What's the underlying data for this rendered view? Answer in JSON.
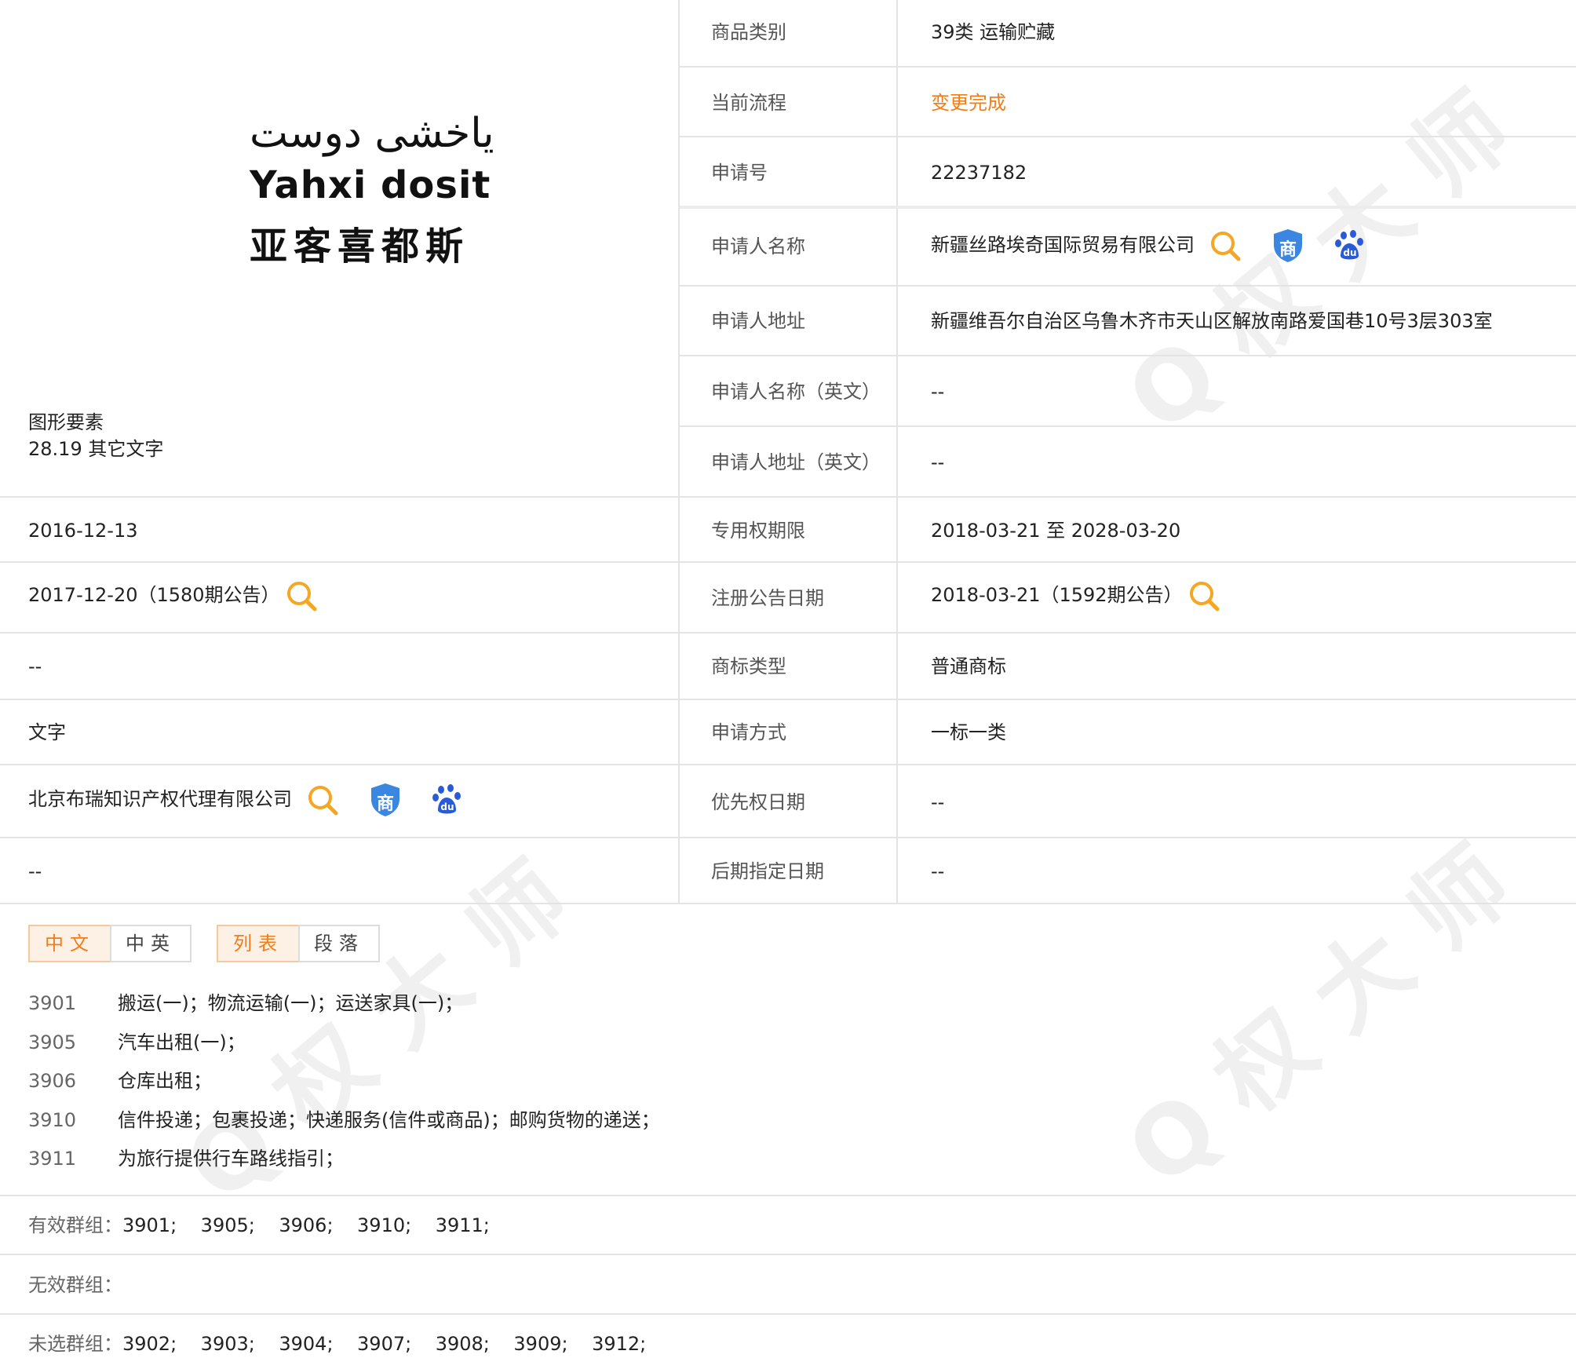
{
  "logo": {
    "arabic": "ياخشى دوست",
    "latin": "Yahxi dosit",
    "chinese": "亚客喜都斯"
  },
  "figure_elements": {
    "label": "图形要素",
    "value": "28.19 其它文字"
  },
  "left_values": {
    "application_date": "2016-12-13",
    "preliminary_notice": "2017-12-20（1580期公告）",
    "row3": "--",
    "mark_form": "文字",
    "agent": "北京布瑞知识产权代理有限公司",
    "row6": "--"
  },
  "right_rows": {
    "goods_class": {
      "label": "商品类别",
      "value": "39类 运输贮藏"
    },
    "process": {
      "label": "当前流程",
      "value": "变更完成"
    },
    "app_no": {
      "label": "申请号",
      "value": "22237182"
    },
    "applicant": {
      "label": "申请人名称",
      "value": "新疆丝路埃奇国际贸易有限公司"
    },
    "address": {
      "label": "申请人地址",
      "value": "新疆维吾尔自治区乌鲁木齐市天山区解放南路爱国巷10号3层303室"
    },
    "applicant_en": {
      "label": "申请人名称（英文）",
      "value": "--"
    },
    "address_en": {
      "label": "申请人地址（英文）",
      "value": "--"
    },
    "exclusive_period": {
      "label": "专用权期限",
      "value": "2018-03-21 至 2028-03-20"
    },
    "reg_notice_date": {
      "label": "注册公告日期",
      "value": "2018-03-21（1592期公告）"
    },
    "mark_type": {
      "label": "商标类型",
      "value": "普通商标"
    },
    "filing_method": {
      "label": "申请方式",
      "value": "一标一类"
    },
    "priority_date": {
      "label": "优先权日期",
      "value": "--"
    },
    "later_designation": {
      "label": "后期指定日期",
      "value": "--"
    }
  },
  "tabs": {
    "lang_zh": "中文",
    "lang_zh_en": "中英",
    "view_list": "列表",
    "view_paragraph": "段落"
  },
  "goods": [
    {
      "code": "3901",
      "desc": "搬运(一)；物流运输(一)；运送家具(一)；"
    },
    {
      "code": "3905",
      "desc": "汽车出租(一)；"
    },
    {
      "code": "3906",
      "desc": "仓库出租；"
    },
    {
      "code": "3910",
      "desc": "信件投递；包裹投递；快递服务(信件或商品)；邮购货物的递送；"
    },
    {
      "code": "3911",
      "desc": "为旅行提供行车路线指引；"
    }
  ],
  "groups": {
    "valid_label": "有效群组：",
    "valid_value": "3901;    3905;    3906;    3910;    3911;",
    "invalid_label": "无效群组：",
    "invalid_value": "",
    "unselected_label": "未选群组：",
    "unselected_value": "3902;    3903;    3904;    3907;    3908;    3909;    3912;"
  },
  "icons": {
    "search": "search-icon",
    "shang": "trademark-shield-icon",
    "baidu": "baidu-paw-icon",
    "shield_char": "商",
    "paw_text": "du"
  },
  "colors": {
    "accent": "#f07d1a",
    "shield": "#3a86e0",
    "baidu": "#2a5bd7",
    "border": "#e4e4e4"
  }
}
